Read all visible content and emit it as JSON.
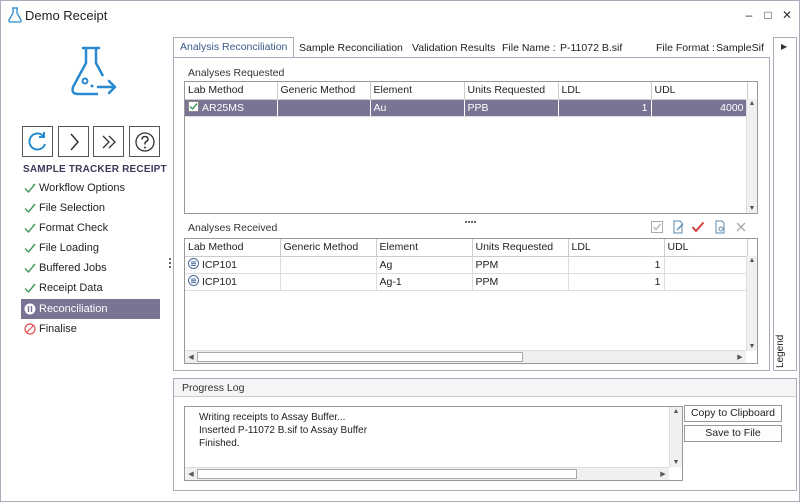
{
  "window": {
    "title": "Demo Receipt",
    "minimize": "–",
    "maximize": "□",
    "close": "✕"
  },
  "sidebar": {
    "heading": "SAMPLE TRACKER RECEIPT",
    "tools": [
      {
        "icon": "refresh-icon"
      },
      {
        "icon": "chevron-right-icon"
      },
      {
        "icon": "double-chevron-right-icon"
      },
      {
        "icon": "help-icon"
      }
    ],
    "steps": [
      {
        "label": "Workflow Options",
        "state": "done"
      },
      {
        "label": "File Selection",
        "state": "done"
      },
      {
        "label": "Format Check",
        "state": "done"
      },
      {
        "label": "File Loading",
        "state": "done"
      },
      {
        "label": "Buffered Jobs",
        "state": "done"
      },
      {
        "label": "Receipt Data",
        "state": "done"
      },
      {
        "label": "Reconciliation",
        "state": "active"
      },
      {
        "label": "Finalise",
        "state": "blocked"
      }
    ]
  },
  "tabs": [
    {
      "label": "Analysis Reconciliation",
      "active": true
    },
    {
      "label": "Sample Reconciliation",
      "active": false
    },
    {
      "label": "Validation Results",
      "active": false
    }
  ],
  "file_info": {
    "name_label": "File Name :",
    "name_value": "P-11072 B.sif",
    "format_label": "File Format :",
    "format_value": "SampleSif"
  },
  "legend": {
    "label": "Legend",
    "arrow": "▶"
  },
  "requested": {
    "title": "Analyses Requested",
    "columns": [
      "Lab Method",
      "Generic Method",
      "Element",
      "Units Requested",
      "LDL",
      "UDL"
    ],
    "rows": [
      {
        "lab_method": "AR25MS",
        "generic_method": "",
        "element": "Au",
        "units": "PPB",
        "ldl": "1",
        "udl": "4000"
      }
    ]
  },
  "received": {
    "title": "Analyses Received",
    "columns": [
      "Lab Method",
      "Generic Method",
      "Element",
      "Units Requested",
      "LDL",
      "UDL"
    ],
    "rows": [
      {
        "lab_method": "ICP101",
        "generic_method": "",
        "element": "Ag",
        "units": "PPM",
        "ldl": "1",
        "udl": ""
      },
      {
        "lab_method": "ICP101",
        "generic_method": "",
        "element": "Ag-1",
        "units": "PPM",
        "ldl": "1",
        "udl": ""
      }
    ],
    "toolbar_icons": [
      "check-all-icon",
      "edit-doc-icon",
      "accept-check-icon",
      "settings-doc-icon",
      "delete-x-icon"
    ]
  },
  "progress_log": {
    "title": "Progress Log",
    "lines": [
      "Writing receipts to Assay Buffer...",
      "Inserted P-11072 B.sif to Assay Buffer",
      "Finished."
    ],
    "copy_button": "Copy to Clipboard",
    "save_button": "Save to File"
  },
  "colors": {
    "accent": "#7a7393",
    "check": "#3a9a5a",
    "blocked": "#e05050",
    "logo": "#2a8ad0"
  }
}
